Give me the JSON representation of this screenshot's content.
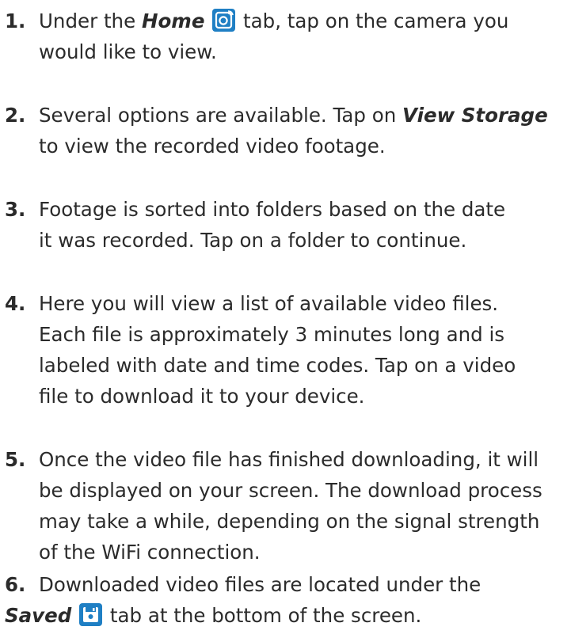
{
  "steps": [
    {
      "number": "1.",
      "line1_pre": "Under the ",
      "line1_em": "Home",
      "line1_icon": "home-camera-icon",
      "line1_post": " tab, tap on the camera you",
      "line2": "would like to view."
    },
    {
      "number": "2.",
      "line1_pre": "Several options are available. Tap on ",
      "line1_em": "View Storage",
      "line2": "to view the recorded video footage."
    },
    {
      "number": "3.",
      "line1": "Footage is sorted into folders based on the date",
      "line2": "it was recorded. Tap on a folder to continue."
    },
    {
      "number": "4.",
      "line1": "Here you will view a list of available video files.",
      "line2": "Each file is approximately 3 minutes long and is",
      "line3": "labeled with date and time codes. Tap on a video",
      "line4": "file to download it to your device."
    },
    {
      "number": "5.",
      "line1": "Once the video file has finished downloading, it will",
      "line2": "be displayed on your screen. The download process",
      "line3": "may take a while, depending on the signal strength",
      "line4": "of the WiFi connection."
    },
    {
      "number": "6.",
      "line1": "Downloaded video files are located under the",
      "line2_em": "Saved",
      "line2_icon": "saved-floppy-icon",
      "line2_post": " tab at the bottom of the screen."
    }
  ],
  "colors": {
    "text": "#2b2b2b",
    "icon_bg": "#1f7fc4"
  }
}
